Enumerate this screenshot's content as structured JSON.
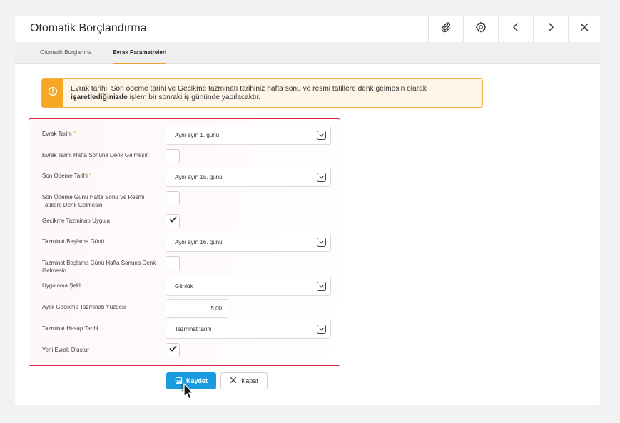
{
  "window": {
    "title": "Otomatik Borçlandırma"
  },
  "tabs": [
    {
      "label": "Otomatik Borçlanma",
      "active": false
    },
    {
      "label": "Evrak Parametreleri",
      "active": true
    }
  ],
  "alert": {
    "text_part1": "Evrak tarihi, Son ödeme tarihi ve Gecikme tazminatı tarihiniz hafta sonu ve resmi tatillere denk gelmesin olarak",
    "text_bold": "işaretlediğinizde",
    "text_part2": " işlem bir sonraki iş gününde yapılacaktır."
  },
  "form": {
    "evrak_tarihi": {
      "label": "Evrak Tarihi",
      "required_mark": "*",
      "value": "Aynı ayın 1. günü"
    },
    "evrak_hafta_sonu": {
      "label": "Evrak Tarihi Hafta Sonuna Denk Gelmesin",
      "checked": false
    },
    "son_odeme_tarihi": {
      "label": "Son Ödeme Tarihi",
      "required_mark": "*",
      "value": "Aynı ayın 15. günü"
    },
    "son_odeme_hafta_sonu": {
      "label": "Son Ödeme Günü Hafta Sonu Ve Resmi Tatillere Denk Gelmesin",
      "checked": false
    },
    "gecikme_tazminati": {
      "label": "Gecikme Tazminatı Uygula",
      "checked": true
    },
    "tazminat_baslama": {
      "label": "Tazminat Başlama Günü",
      "value": "Aynı ayın 16. günü"
    },
    "tazminat_hafta_sonu": {
      "label": "Tazminat Başlama Günü Hafta Sonuna Denk Gelmesin",
      "checked": false
    },
    "uygulama_sekli": {
      "label": "Uygulama Şekli",
      "value": "Günlük"
    },
    "aylik_yuzde": {
      "label": "Aylık Gecikme Tazminatı Yüzdesi",
      "value": "5,00"
    },
    "hesap_tarihi": {
      "label": "Tazminat Hesap Tarihi",
      "value": "Tazminat tarihi"
    },
    "yeni_evrak": {
      "label": "Yeni Evrak Oluştur",
      "checked": true
    }
  },
  "buttons": {
    "save": "Kaydet",
    "close": "Kapat"
  },
  "colors": {
    "primary": "#1a9be0",
    "warning": "#f5a623",
    "form_border": "#d8283f",
    "tab_underline": "#f0a030"
  },
  "icons": [
    "paperclip-icon",
    "gear-icon",
    "chevron-left-icon",
    "chevron-right-icon",
    "close-icon",
    "warning-icon",
    "chevron-down-icon",
    "checkmark-icon",
    "save-icon",
    "x-icon",
    "cursor-icon"
  ]
}
